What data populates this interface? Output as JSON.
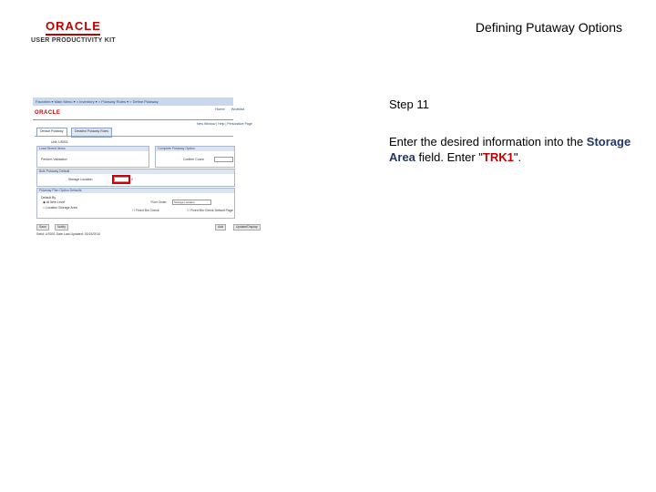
{
  "header": {
    "logo_brand": "ORACLE",
    "logo_subtitle": "USER PRODUCTIVITY KIT",
    "slide_title": "Defining Putaway Options"
  },
  "screenshot": {
    "topbar_text": "Favorites ▾   Main Menu ▾  >  Inventory ▾  >  Putaway Rules ▾  >  Define Putaway",
    "menu_items": [
      "Home",
      "Worklist",
      "Performance Trace",
      "Add to Favorites",
      "Sign out"
    ],
    "brand": "ORACLE",
    "nav_links": "New Window | Help | Personalize Page",
    "tabs": [
      "Default Putaway",
      "Detailed Putaway Rules"
    ],
    "unit_label": "Unit: US001",
    "load_section": "Load Stored Items",
    "load_option": "Perform Validation",
    "complete_section": "Complete Putaway Option",
    "confirm_label": "Confirm Count",
    "bulk_section": "Bulk Putaway Default",
    "storage_area_label": "Storage Location",
    "plan_section": "Putaway Plan Option Defaults",
    "default_by_label": "Default By",
    "radio_1": "At Item Level",
    "radio_2": "Location Storage Area",
    "sort_label": "*Sort Order",
    "sort_value": "Storage Location",
    "checkbox_1": "Fixed Bin Check",
    "checkbox_2": "Fixed Bin Check Default Page",
    "btn_save": "Save",
    "btn_notify": "Notify",
    "btn_add": "Add",
    "btn_update": "Update/Display",
    "footer_text": "Setid: US001   Date Last Updated: 03/15/2010"
  },
  "instructions": {
    "step": "Step 11",
    "line_prefix": "Enter the desired information into the ",
    "field_name": "Storage Area",
    "line_middle": " field. Enter \"",
    "value": "TRK1",
    "line_suffix": "\"."
  }
}
